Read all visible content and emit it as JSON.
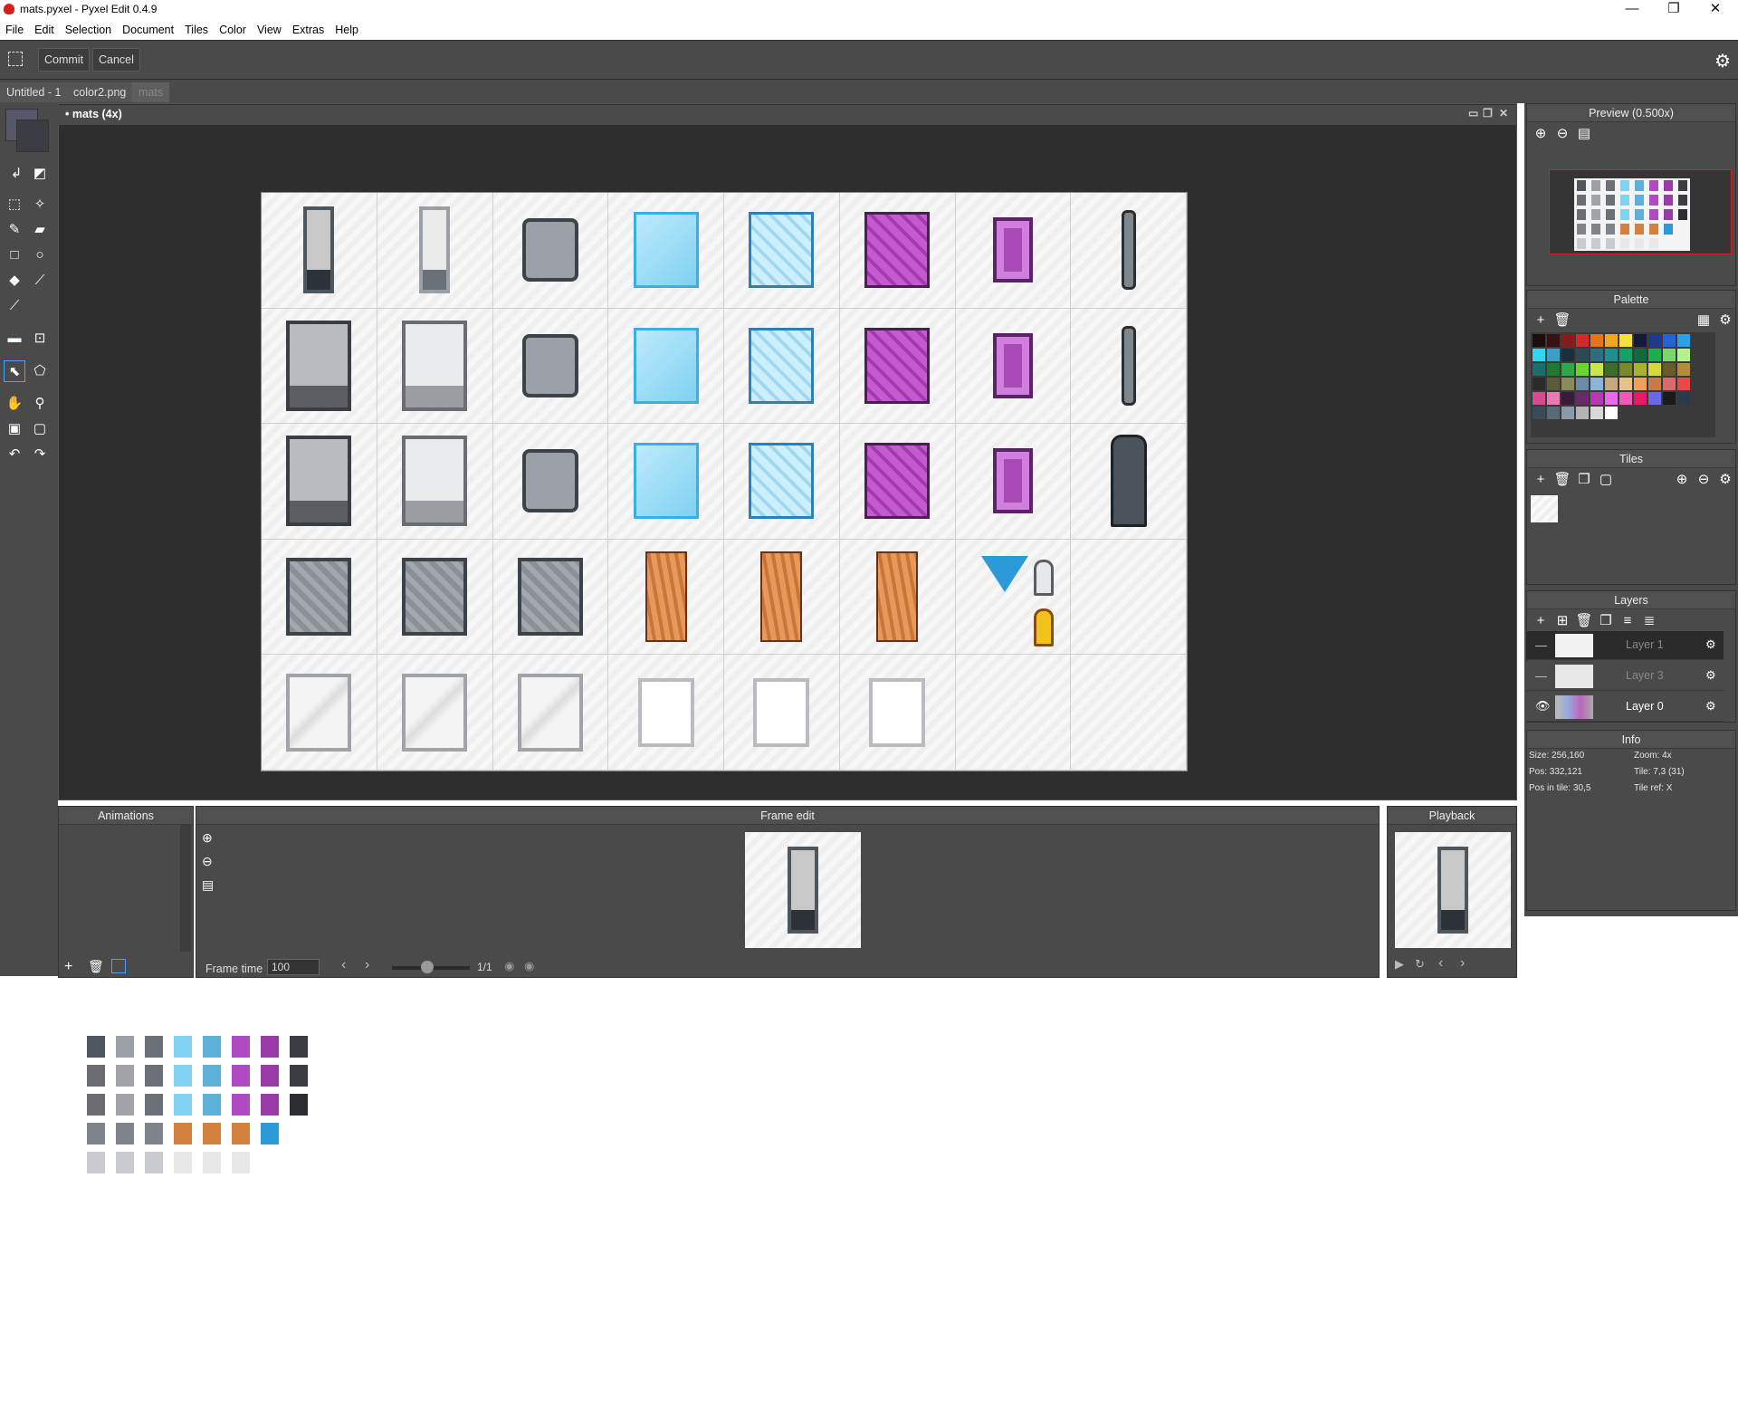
{
  "window": {
    "title": "mats.pyxel - Pyxel Edit 0.4.9",
    "minimize": "—",
    "maximize": "❐",
    "close": "✕"
  },
  "menu": [
    "File",
    "Edit",
    "Selection",
    "Document",
    "Tiles",
    "Color",
    "View",
    "Extras",
    "Help"
  ],
  "toolbar": {
    "commit": "Commit",
    "cancel": "Cancel"
  },
  "doc_tabs": [
    "Untitled - 1",
    "color2.png",
    "mats"
  ],
  "document": {
    "title": "• mats   (4x)"
  },
  "panels": {
    "preview": "Preview (0.500x)",
    "palette": "Palette",
    "tiles": "Tiles",
    "layers": "Layers",
    "info": "Info",
    "animations": "Animations",
    "frame_edit": "Frame edit",
    "playback": "Playback"
  },
  "layers": [
    {
      "name": "Layer 1",
      "visible": false,
      "selected": true
    },
    {
      "name": "Layer 3",
      "visible": false,
      "selected": false
    },
    {
      "name": "Layer 0",
      "visible": true,
      "selected": false
    }
  ],
  "info": {
    "size": "Size: 256,160",
    "zoom": "Zoom: 4x",
    "pos": "Pos: 332,121",
    "tile": "Tile: 7,3 (31)",
    "pos_in_tile": "Pos in tile: 30,5",
    "tile_ref": "Tile ref: X"
  },
  "frame": {
    "label": "Frame time",
    "value": "100",
    "counter": "1/1"
  },
  "palette_colors": [
    "#1b0e0e",
    "#3a1010",
    "#8b1a1a",
    "#d22b2b",
    "#e8731c",
    "#f2a81c",
    "#f5e13b",
    "#141a3c",
    "#1f3a8a",
    "#2463d8",
    "#2ba1e8",
    "#33d6f0",
    "#3aa0c8",
    "#1a2f3c",
    "#2d4a57",
    "#2d6e82",
    "#1f8f8f",
    "#12a36b",
    "#0f6b3b",
    "#1bb04a",
    "#7ad66b",
    "#b4f08c",
    "#1a6e6e",
    "#1f7a30",
    "#2da84a",
    "#6ad62d",
    "#c8e84a",
    "#3b6e2a",
    "#7a8a2a",
    "#a8b42d",
    "#d8d83b",
    "#6b5a2a",
    "#b48a3b",
    "#2a2a2a",
    "#5a5a3a",
    "#8a8a5a",
    "#6a8aa8",
    "#8ab4d8",
    "#c8a87a",
    "#e8c08a",
    "#f0a05a",
    "#c87a4a",
    "#d86a6a",
    "#e84a4a",
    "#d84a8a",
    "#e87ab4",
    "#3a1a3a",
    "#6a2a6a",
    "#b43ab4",
    "#e86ae8",
    "#f05ab4",
    "#e81a6a",
    "#6a6ae8",
    "#1a1a1a",
    "#2a3a4a",
    "#3a4a5a",
    "#5a6a7a",
    "#8a9aaa",
    "#b4b4b4",
    "#d8d8d8",
    "#ffffff"
  ]
}
